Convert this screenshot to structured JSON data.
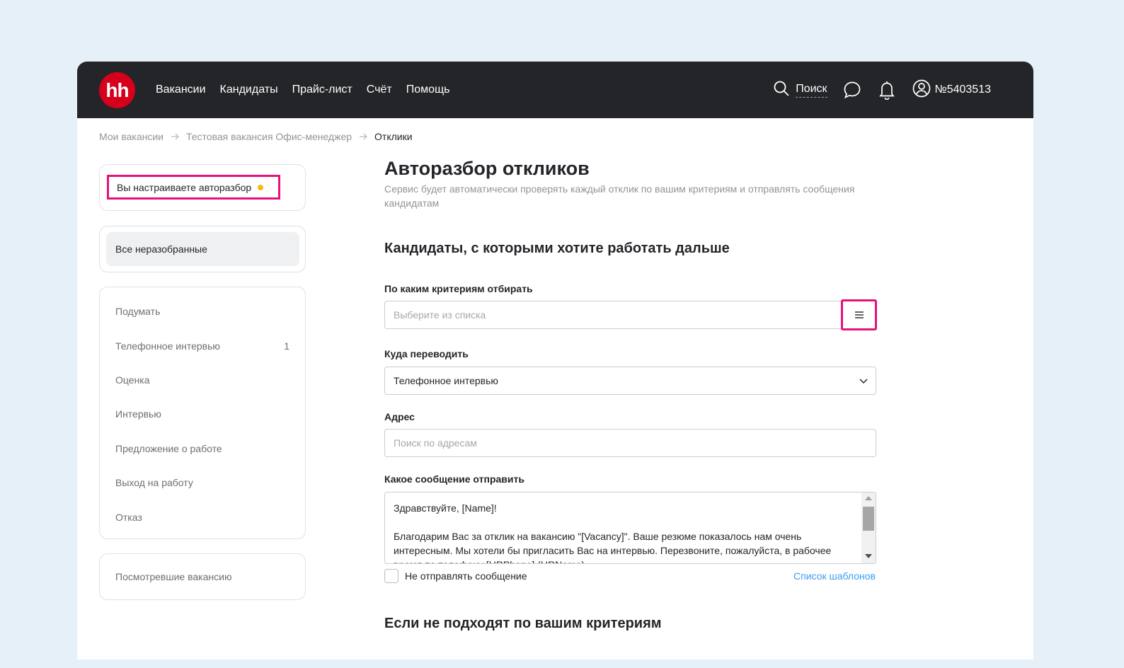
{
  "header": {
    "logo_text": "hh",
    "nav": [
      "Вакансии",
      "Кандидаты",
      "Прайс-лист",
      "Счёт",
      "Помощь"
    ],
    "search_label": "Поиск",
    "account_id": "№5403513"
  },
  "breadcrumb": {
    "items": [
      "Мои вакансии",
      "Тестовая вакансия Офис-менеджер",
      "Отклики"
    ]
  },
  "sidebar": {
    "status_text": "Вы настраиваете авторазбор",
    "selected_folder": "Все неразобранные",
    "folders": [
      {
        "label": "Подумать",
        "count": ""
      },
      {
        "label": "Телефонное интервью",
        "count": "1"
      },
      {
        "label": "Оценка",
        "count": ""
      },
      {
        "label": "Интервью",
        "count": ""
      },
      {
        "label": "Предложение о работе",
        "count": ""
      },
      {
        "label": "Выход на работу",
        "count": ""
      },
      {
        "label": "Отказ",
        "count": ""
      }
    ],
    "viewed": "Посмотревшие вакансию"
  },
  "main": {
    "title": "Авторазбор откликов",
    "description": "Сервис будет автоматически проверять каждый отклик по вашим критериям и отправлять сообщения кандидатам",
    "section1_title": "Кандидаты, с которыми хотите работать дальше",
    "criteria_label": "По каким критериям отбирать",
    "criteria_placeholder": "Выберите из списка",
    "move_label": "Куда переводить",
    "move_value": "Телефонное интервью",
    "address_label": "Адрес",
    "address_placeholder": "Поиск по адресам",
    "message_label": "Какое сообщение отправить",
    "message_text": "Здравствуйте, [Name]!\n\nБлагодарим Вас за отклик на вакансию \"[Vacancy]\". Ваше резюме показалось нам очень интересным. Мы хотели бы пригласить Вас на интервью. Перезвоните, пожалуйста, в рабочее время по телефону [HRPhone] (HRName).",
    "no_message_label": "Не отправлять сообщение",
    "templates_link": "Список шаблонов",
    "section2_title": "Если не подходят по вашим критериям"
  },
  "colors": {
    "accent": "#e5127d",
    "brand": "#d6001c",
    "link": "#3c9df2",
    "status_dot": "#f5bb0e"
  },
  "icons": [
    "search-icon",
    "chat-icon",
    "bell-icon",
    "user-icon",
    "arrow-right-icon",
    "menu-icon",
    "chevron-down-icon"
  ]
}
